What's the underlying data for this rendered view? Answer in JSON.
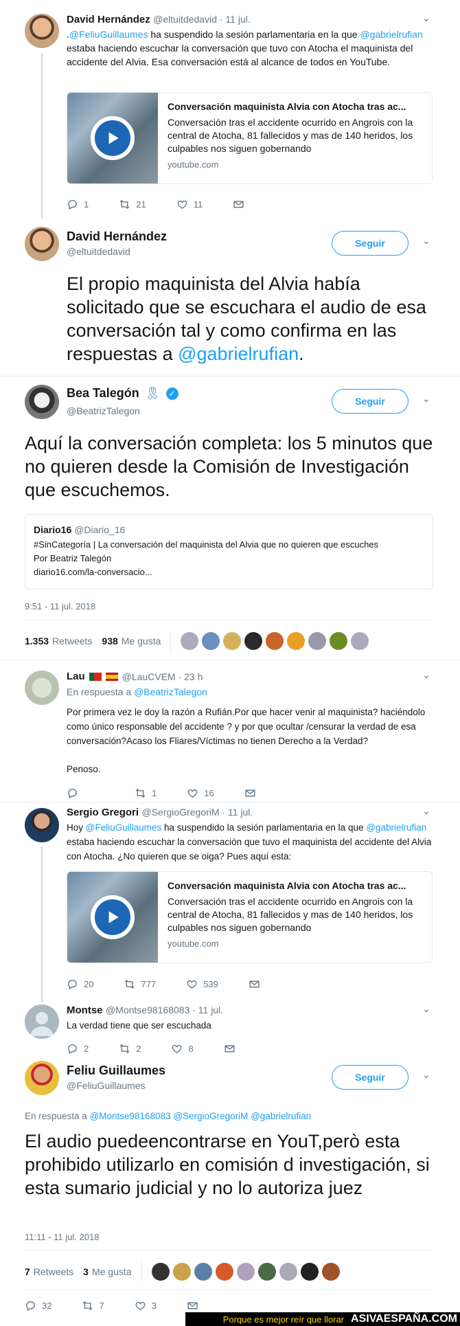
{
  "tweet1": {
    "name": "David Hernández",
    "handle": "@eltuitdedavid · 11 jul.",
    "text_pre": ".",
    "mention1": "@FeliuGuillaumes",
    "text_mid1": " ha suspendido la sesión parlamentaria en la que",
    "mention2": "@gabrielrufian",
    "text_mid2": " estaba haciendo escuchar la conversación que tuvo con Atocha el maquinista del accidente del Alvia. Esa conversación está al alcance de todos en YouTube.",
    "card": {
      "title": "Conversación maquinista Alvia con Atocha tras ac...",
      "desc": "Conversación tras el accidente ocurrido en Angrois con la central de Atocha, 81 fallecidos y mas de 140 heridos, los culpables nos siguen gobernando",
      "domain": "youtube.com"
    },
    "replies": "1",
    "retweets": "21",
    "likes": "11"
  },
  "tweet2": {
    "name": "David Hernández",
    "handle": "@eltuitdedavid",
    "follow": "Seguir",
    "text": "El propio maquinista del Alvia había solicitado que se escuchara el audio de esa conversación tal y como confirma en las respuestas a ",
    "mention": "@gabrielrufian",
    "text_end": "."
  },
  "tweet3": {
    "name": "Bea Talegón",
    "handle": "@BeatrizTalegon",
    "follow": "Seguir",
    "text": "Aquí la conversación completa: los 5 minutos que no quieren desde la Comisión de Investigación que escuchemos.",
    "quote": {
      "name": "Diario16",
      "handle": "@Diario_16",
      "line1": "#SinCategoría | La conversación del maquinista del Alvia que no quieren que escuches",
      "line2": "Por Beatriz Talegón",
      "line3": "diario16.com/la-conversacio..."
    },
    "time": "9:51 - 11 jul. 2018",
    "retweets_num": "1.353",
    "retweets_label": "Retweets",
    "likes_num": "938",
    "likes_label": "Me gusta"
  },
  "tweet4": {
    "name": "Lau",
    "handle": "@LauCVEM · 23 h",
    "reply_prefix": "En respuesta a ",
    "reply_to": "@BeatrizTalegon",
    "text": "Por primera vez le doy la razón a Rufián.Por que hacer venir al maquinista? haciéndolo como único responsable del accidente ? y por que ocultar /censurar la verdad de esa conversación?Acaso los Fliares/Víctimas no tienen Derecho a la Verdad?",
    "text2": "Penoso.",
    "replies": "",
    "retweets": "1",
    "likes": "16"
  },
  "tweet5": {
    "name": "Sergio Gregori",
    "handle": "@SergioGregoriM · 11 jul.",
    "text_pre": "Hoy ",
    "mention1": "@FeliuGuillaumes",
    "text_mid1": " ha suspendido la sesión parlamentaria en la que ",
    "mention2": "@gabrielrufian",
    "text_mid2": " estaba haciendo escuchar la conversación que tuvo el maquinista del accidente del Alvia con Atocha. ¿No quieren que se oiga? Pues aquí esta:",
    "card": {
      "title": "Conversación maquinista Alvia con Atocha tras ac...",
      "desc": "Conversación tras el accidente ocurrido en Angrois con la central de Atocha, 81 fallecidos y mas de 140 heridos, los culpables nos siguen gobernando",
      "domain": "youtube.com"
    },
    "replies": "20",
    "retweets": "777",
    "likes": "539"
  },
  "tweet6": {
    "name": "Montse",
    "handle": "@Montse98168083 · 11 jul.",
    "text": "La verdad tiene que ser escuchada",
    "replies": "2",
    "retweets": "2",
    "likes": "8"
  },
  "tweet7": {
    "name": "Feliu Guillaumes",
    "handle": "@FeliuGuillaumes",
    "follow": "Seguir",
    "reply_prefix": "En respuesta a ",
    "reply_to": "@Montse98168083 @SergioGregoriM @gabrielrufian",
    "text": "El audio puedeencontrarse en YouT,però esta prohibido utilizarlo en comisión d investigación, si esta sumario judicial y no lo autoriza juez",
    "time": "11:11 - 11 jul. 2018",
    "retweets_num": "7",
    "retweets_label": "Retweets",
    "likes_num": "3",
    "likes_label": "Me gusta",
    "replies": "32",
    "retweets": "7",
    "likes": "3"
  },
  "footer": {
    "slogan": "Porque es mejor reír que llorar",
    "site": "ASIVAESPAÑA.COM"
  },
  "colors": {
    "accent": "#1da1f2",
    "text": "#14171a",
    "muted": "#657786",
    "verified": "#1da1f2"
  }
}
